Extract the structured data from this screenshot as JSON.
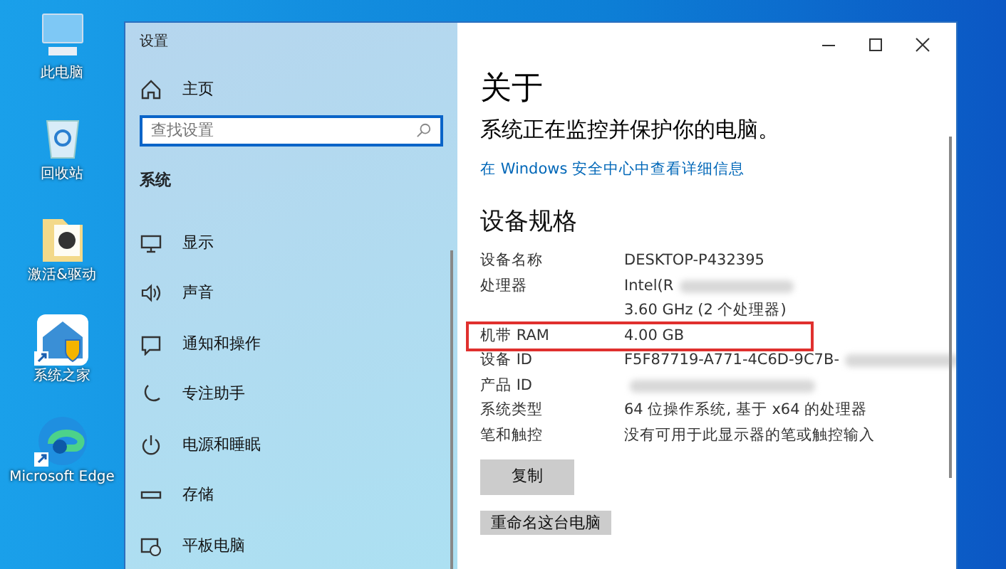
{
  "desktop_icons": [
    {
      "kind": "computer",
      "label": "此电脑",
      "shortcut": false
    },
    {
      "kind": "recycle",
      "label": "回收站",
      "shortcut": false
    },
    {
      "kind": "folder",
      "label": "激活&驱动",
      "shortcut": false
    },
    {
      "kind": "house",
      "label": "系统之家",
      "shortcut": true
    },
    {
      "kind": "edge",
      "label": "Microsoft Edge",
      "shortcut": true
    }
  ],
  "window": {
    "title": "设置"
  },
  "sidebar": {
    "home": "主页",
    "search": {
      "placeholder": "查找设置"
    },
    "section": "系统",
    "items": [
      {
        "kind": "display",
        "label": "显示"
      },
      {
        "kind": "sound",
        "label": "声音"
      },
      {
        "kind": "notify",
        "label": "通知和操作"
      },
      {
        "kind": "moon",
        "label": "专注助手"
      },
      {
        "kind": "power",
        "label": "电源和睡眠"
      },
      {
        "kind": "storage",
        "label": "存储"
      },
      {
        "kind": "tablet",
        "label": "平板电脑"
      }
    ]
  },
  "content": {
    "title": "关于",
    "status": "系统正在监控并保护你的电脑。",
    "link": "在 Windows 安全中心中查看详细信息",
    "section": "设备规格",
    "specs": [
      {
        "label": "设备名称",
        "value": [
          "DESKTOP-P432395"
        ],
        "blurred": false,
        "highlighted": false
      },
      {
        "label": "处理器",
        "value": [
          "Intel(R",
          "3.60 GHz  (2 个处理器)"
        ],
        "blurred": true,
        "highlighted": false
      },
      {
        "label": "机带 RAM",
        "value": [
          "4.00 GB"
        ],
        "blurred": false,
        "highlighted": true
      },
      {
        "label": "设备 ID",
        "value": [
          "F5F87719-A771-4C6D-9C7B-"
        ],
        "blurred": true,
        "highlighted": false
      },
      {
        "label": "产品 ID",
        "blurred": true,
        "highlighted": false
      },
      {
        "label": "系统类型",
        "value": [
          "64 位操作系统, 基于 x64 的处理器"
        ],
        "blurred": false,
        "highlighted": false
      },
      {
        "label": "笔和触控",
        "value": [
          "没有可用于此显示器的笔或触控输入"
        ],
        "blurred": false,
        "highlighted": false
      }
    ],
    "buttons": [
      "复制",
      "重命名这台电脑"
    ]
  }
}
